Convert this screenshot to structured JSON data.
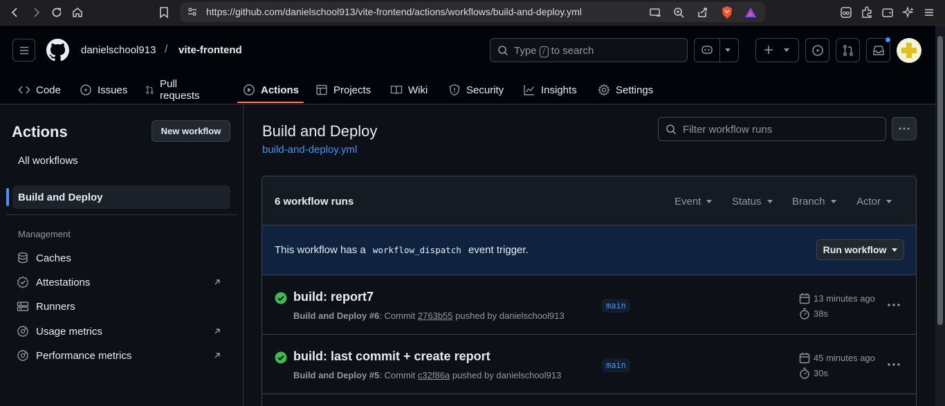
{
  "browser": {
    "url": "https://github.com/danielschool913/vite-frontend/actions/workflows/build-and-deploy.yml"
  },
  "header": {
    "owner": "danielschool913",
    "separator": "/",
    "repo": "vite-frontend",
    "search_prefix": "Type",
    "search_key": "/",
    "search_suffix": "to search"
  },
  "tabs": [
    {
      "label": "Code",
      "icon": "code-icon"
    },
    {
      "label": "Issues",
      "icon": "issue-icon"
    },
    {
      "label": "Pull requests",
      "icon": "pull-request-icon"
    },
    {
      "label": "Actions",
      "icon": "play-icon",
      "active": true
    },
    {
      "label": "Projects",
      "icon": "table-icon"
    },
    {
      "label": "Wiki",
      "icon": "book-icon"
    },
    {
      "label": "Security",
      "icon": "shield-icon"
    },
    {
      "label": "Insights",
      "icon": "graph-icon"
    },
    {
      "label": "Settings",
      "icon": "gear-icon"
    }
  ],
  "sidebar": {
    "title": "Actions",
    "new_workflow": "New workflow",
    "all_workflows": "All workflows",
    "active_workflow": "Build and Deploy",
    "management_label": "Management",
    "items": [
      {
        "label": "Caches",
        "icon": "database-icon"
      },
      {
        "label": "Attestations",
        "icon": "verified-icon"
      },
      {
        "label": "Runners",
        "icon": "server-icon"
      },
      {
        "label": "Usage metrics",
        "icon": "meter-icon"
      },
      {
        "label": "Performance metrics",
        "icon": "meter-icon"
      }
    ]
  },
  "main": {
    "title": "Build and Deploy",
    "file": "build-and-deploy.yml",
    "filter_placeholder": "Filter workflow runs",
    "runs_count": "6 workflow runs",
    "filters": [
      "Event",
      "Status",
      "Branch",
      "Actor"
    ],
    "dispatch_prefix": "This workflow has a",
    "dispatch_code": "workflow_dispatch",
    "dispatch_suffix": "event trigger.",
    "run_workflow": "Run workflow",
    "runs": [
      {
        "title": "build: report7",
        "workflow": "Build and Deploy",
        "number": "#6",
        "commit_label": "Commit",
        "sha": "2763b55",
        "pushed_by": "pushed by danielschool913",
        "branch": "main",
        "time": "13 minutes ago",
        "duration": "38s"
      },
      {
        "title": "build: last commit + create report",
        "workflow": "Build and Deploy",
        "number": "#5",
        "commit_label": "Commit",
        "sha": "c32f86a",
        "pushed_by": "pushed by danielschool913",
        "branch": "main",
        "time": "45 minutes ago",
        "duration": "30s"
      }
    ]
  },
  "colors": {
    "accent": "#4493f8",
    "success": "#3fb950",
    "tab_underline": "#f78166"
  }
}
